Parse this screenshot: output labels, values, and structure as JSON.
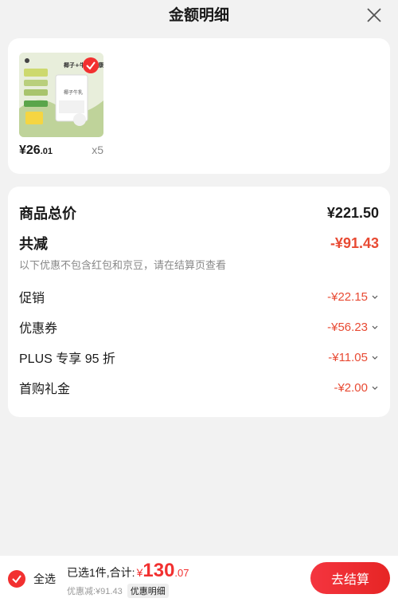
{
  "header": {
    "title": "金额明细"
  },
  "product": {
    "price_int": "¥26",
    "price_dec": ".01",
    "qty": "x5",
    "thumb_caption": "椰子+牛乳 健康",
    "thumb_pack_label": "椰子牛乳"
  },
  "detail": {
    "total_label": "商品总价",
    "total_value": "¥221.50",
    "reduce_label": "共减",
    "reduce_value": "-¥91.43",
    "note": "以下优惠不包含红包和京豆，请在结算页查看",
    "items": [
      {
        "label": "促销",
        "value": "-¥22.15"
      },
      {
        "label": "优惠券",
        "value": "-¥56.23"
      },
      {
        "label": "PLUS 专享 95 折",
        "value": "-¥11.05"
      },
      {
        "label": "首购礼金",
        "value": "-¥2.00"
      }
    ]
  },
  "footer": {
    "select_all": "全选",
    "summary_prefix": "已选1件,合计:",
    "currency": "¥",
    "amount_int": "130",
    "amount_dec": ".07",
    "discount_text": "优惠减:¥91.43",
    "detail_link": "优惠明细",
    "pay_button": "去结算"
  },
  "colors": {
    "accent_red": "#f23030",
    "discount_red": "#e84a33",
    "background": "#f2f2f2"
  }
}
